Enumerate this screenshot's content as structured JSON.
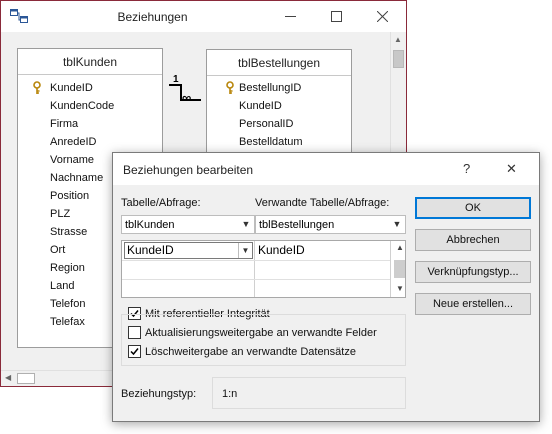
{
  "relationships_window": {
    "title": "Beziehungen",
    "tables": [
      {
        "name": "tblKunden",
        "fields": [
          "KundeID",
          "KundenCode",
          "Firma",
          "AnredeID",
          "Vorname",
          "Nachname",
          "Position",
          "PLZ",
          "Strasse",
          "Ort",
          "Region",
          "Land",
          "Telefon",
          "Telefax"
        ],
        "key_field_index": 0
      },
      {
        "name": "tblBestellungen",
        "fields": [
          "BestellungID",
          "KundeID",
          "PersonalID",
          "Bestelldatum"
        ],
        "key_field_index": 0
      }
    ],
    "relation": {
      "one_side": "1",
      "many_side": "∞"
    }
  },
  "dialog": {
    "title": "Beziehungen bearbeiten",
    "help": "?",
    "close": "✕",
    "table_label": "Tabelle/Abfrage:",
    "related_label": "Verwandte Tabelle/Abfrage:",
    "table_value": "tblKunden",
    "related_value": "tblBestellungen",
    "grid_rows": [
      {
        "left": "KundeID",
        "right": "KundeID"
      },
      {
        "left": "",
        "right": ""
      },
      {
        "left": "",
        "right": ""
      }
    ],
    "buttons": {
      "ok": "OK",
      "cancel": "Abbrechen",
      "join_type": "Verknüpfungstyp...",
      "create_new": "Neue erstellen..."
    },
    "checkboxes": {
      "integrity": {
        "label": "Mit referentieller Integrität",
        "checked": true
      },
      "cascade_update": {
        "label": "Aktualisierungsweitergabe an verwandte Felder",
        "checked": false
      },
      "cascade_delete": {
        "label": "Löschweitergabe an verwandte Datensätze",
        "checked": true
      }
    },
    "relationship_type_label": "Beziehungstyp:",
    "relationship_type_value": "1:n"
  }
}
